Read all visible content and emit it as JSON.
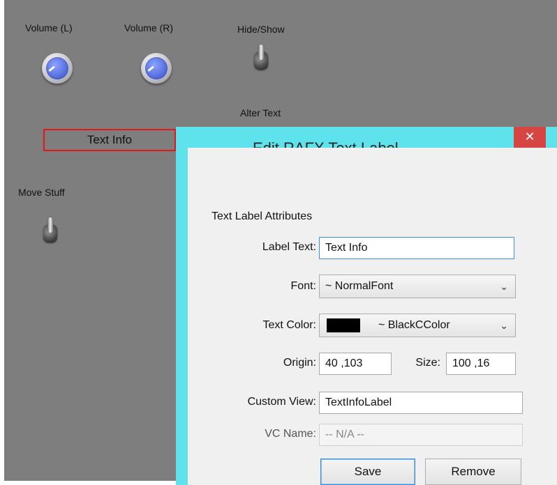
{
  "canvas": {
    "labels": {
      "volume_l": "Volume (L)",
      "volume_r": "Volume (R)",
      "hide_show": "Hide/Show",
      "alter_text": "Alter Text",
      "move_stuff": "Move Stuff"
    },
    "text_info_label": "Text Info"
  },
  "dialog": {
    "title": "Edit RAFX Text Label",
    "close_glyph": "✕",
    "section_title": "Text Label Attributes",
    "fields": {
      "label_text": {
        "label": "Label Text:",
        "value": "Text Info"
      },
      "font": {
        "label": "Font:",
        "value": "~ NormalFont"
      },
      "text_color": {
        "label": "Text Color:",
        "value": "~ BlackCColor",
        "swatch": "#000000"
      },
      "origin": {
        "label": "Origin:",
        "value": "40 ,103"
      },
      "size": {
        "label": "Size:",
        "value": "100 ,16"
      },
      "custom_view": {
        "label": "Custom View:",
        "value": "TextInfoLabel"
      },
      "vc_name": {
        "label": "VC Name:",
        "value": "-- N/A --"
      }
    },
    "buttons": {
      "save": "Save",
      "remove": "Remove"
    }
  },
  "colors": {
    "canvas_bg": "#7e7e7e",
    "dialog_frame": "#5ee2ec",
    "close_red": "#d64541",
    "selection_red": "#e2161b",
    "knob_blue": "#4f67d8"
  }
}
